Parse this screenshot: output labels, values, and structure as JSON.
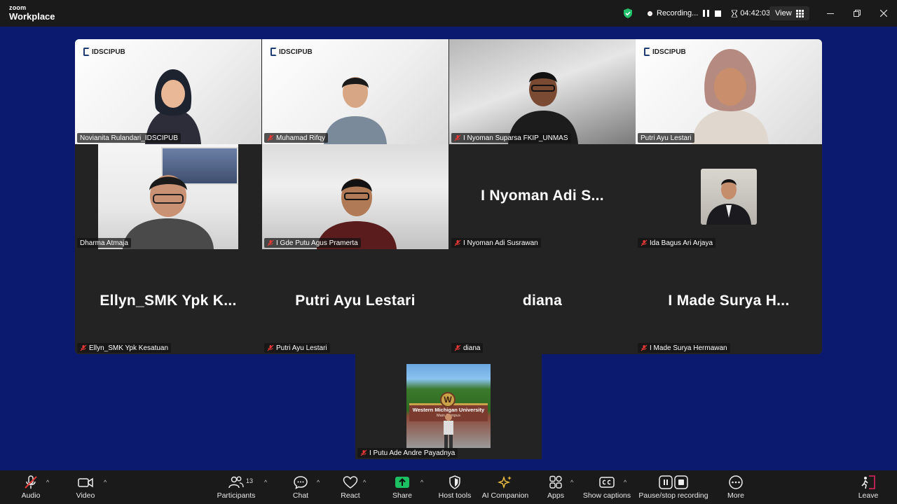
{
  "app": {
    "brand_top": "zoom",
    "brand_bottom": "Workplace"
  },
  "titlebar": {
    "recording_label": "Recording...",
    "timer": "04:42:03",
    "view_label": "View"
  },
  "tiles": [
    {
      "name": "Novianita Rulandari_IDSCIPUB",
      "muted": false,
      "type": "video",
      "active": true,
      "logo": "IDSCIPUB"
    },
    {
      "name": "Muhamad Rifqy",
      "muted": true,
      "type": "video",
      "logo": "IDSCIPUB"
    },
    {
      "name": "I Nyoman Suparsa FKIP_UNMAS",
      "muted": true,
      "type": "video"
    },
    {
      "name": "Putri Ayu Lestari",
      "muted": false,
      "type": "video",
      "logo": "IDSCIPUB"
    },
    {
      "name": "Dharma Atmaja",
      "muted": false,
      "type": "video"
    },
    {
      "name": "I Gde Putu Agus Pramerta",
      "muted": true,
      "type": "video"
    },
    {
      "name": "I Nyoman Adi Susrawan",
      "muted": true,
      "type": "name",
      "display": "I Nyoman Adi S..."
    },
    {
      "name": "Ida Bagus Ari Arjaya",
      "muted": true,
      "type": "avatar"
    },
    {
      "name": "Ellyn_SMK Ypk Kesatuan",
      "muted": true,
      "type": "name",
      "display": "Ellyn_SMK Ypk K..."
    },
    {
      "name": "Putri Ayu Lestari",
      "muted": true,
      "type": "name",
      "display": "Putri Ayu Lestari"
    },
    {
      "name": "diana",
      "muted": true,
      "type": "name",
      "display": "diana"
    },
    {
      "name": "I Made Surya Hermawan",
      "muted": true,
      "type": "name",
      "display": "I Made Surya H..."
    }
  ],
  "bottom_tile": {
    "name": "I Putu Ade Andre Payadnya",
    "muted": true,
    "sign_text": "Western Michigan University",
    "sign_sub": "Main Campus",
    "sign_letter": "W"
  },
  "toolbar": {
    "audio": "Audio",
    "video": "Video",
    "participants": "Participants",
    "participants_count": "13",
    "chat": "Chat",
    "react": "React",
    "share": "Share",
    "host_tools": "Host tools",
    "ai_companion": "AI Companion",
    "apps": "Apps",
    "show_captions": "Show captions",
    "pause_recording": "Pause/stop recording",
    "more": "More",
    "leave": "Leave"
  },
  "colors": {
    "background": "#0b1a6e",
    "active_border": "#3ed99a",
    "share_green": "#1dbf63",
    "leave_red": "#e0245e"
  }
}
